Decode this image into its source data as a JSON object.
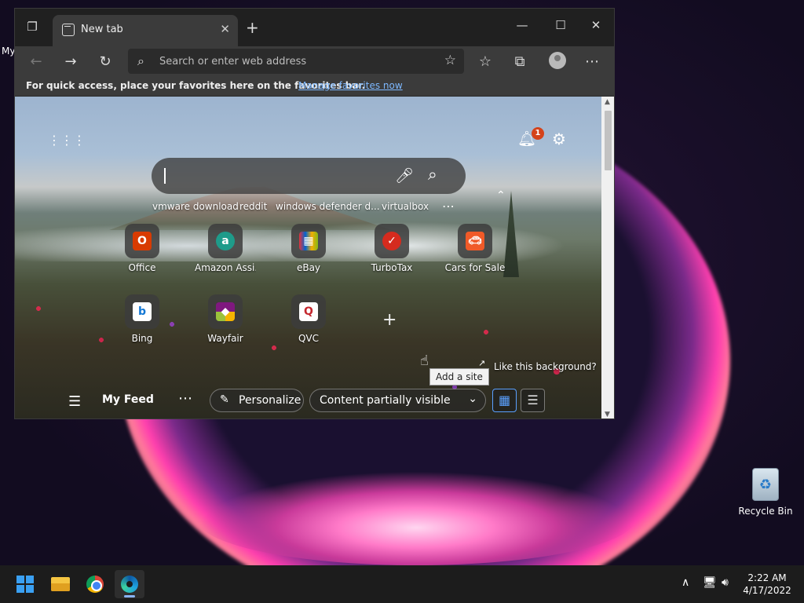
{
  "desktop": {
    "partial_label": "My",
    "recycle_bin": "Recycle Bin"
  },
  "browser": {
    "tab_title": "New tab",
    "address_placeholder": "Search or enter web address",
    "favorites_bar": {
      "message": "For quick access, place your favorites here on the favorites bar.",
      "link": "Manage favorites now"
    }
  },
  "newtab": {
    "notification_count": "1",
    "recent_searches": [
      "vmware download",
      "reddit",
      "windows defender d...",
      "virtualbox"
    ],
    "tiles_row1": [
      "Office",
      "Amazon Assi...",
      "eBay",
      "TurboTax",
      "Cars for Sale"
    ],
    "tiles_row2": [
      "Bing",
      "Wayfair",
      "QVC"
    ],
    "tooltip": "Add a site",
    "like_background": "Like this background?",
    "feed": {
      "title": "My Feed",
      "personalize": "Personalize",
      "content_mode": "Content partially visible"
    }
  },
  "taskbar": {
    "time": "2:22 AM",
    "date": "4/17/2022"
  }
}
